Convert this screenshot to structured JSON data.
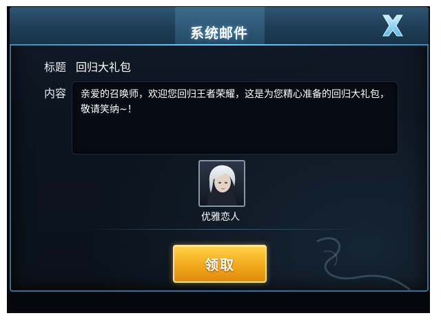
{
  "dialog": {
    "title": "系统邮件",
    "close_icon": "close-x-icon"
  },
  "mail": {
    "subject_label": "标题",
    "subject_value": "回归大礼包",
    "content_label": "内容",
    "content_text": "亲爱的召唤师，欢迎您回归王者荣耀，这是为您精心准备的回归大礼包，敬请笑纳~！"
  },
  "reward": {
    "item_name": "优雅恋人",
    "item_icon": "hero-skin-portrait"
  },
  "actions": {
    "claim_label": "领取"
  },
  "colors": {
    "accent": "#3f87ad",
    "claim_button": "#f3a81b",
    "close_icon": "#8fd8ff"
  }
}
